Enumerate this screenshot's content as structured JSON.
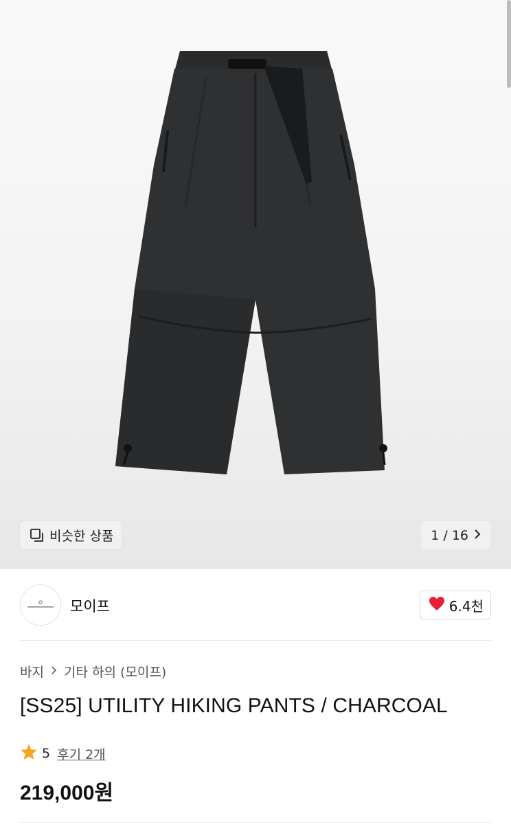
{
  "gallery": {
    "similar_label": "비슷한 상품",
    "pager_label": "1 / 16",
    "pager_icon": "chevron-right-icon",
    "similar_icon": "copy-stack-icon"
  },
  "brand": {
    "name": "모이프",
    "likes": "6.4천",
    "like_icon": "heart-icon",
    "like_color": "#e8213a"
  },
  "breadcrumb": {
    "level1": "바지",
    "level2": "기타 하의 (모이프)"
  },
  "product": {
    "title": "[SS25] UTILITY HIKING PANTS / CHARCOAL",
    "rating": "5",
    "reviews": "후기 2개",
    "price": "219,000원",
    "star_icon": "star-icon",
    "star_color": "#f5a623"
  }
}
